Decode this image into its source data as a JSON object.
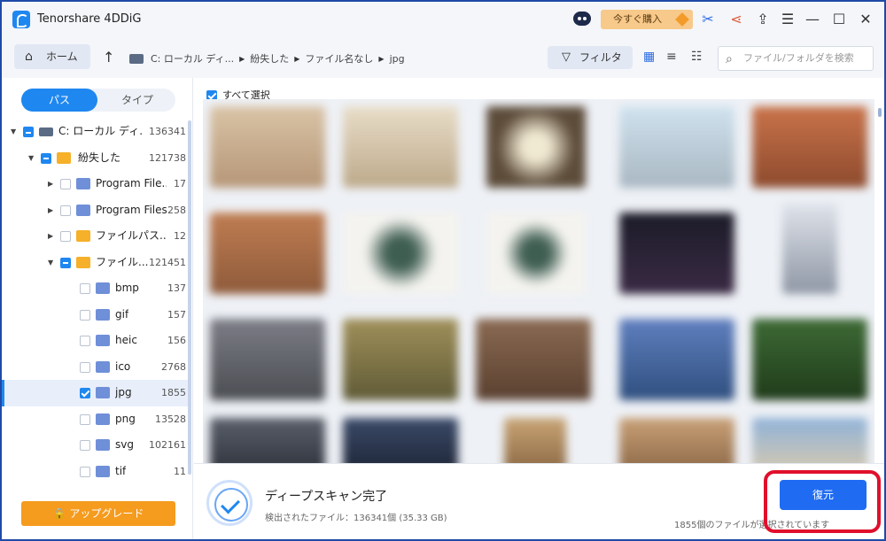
{
  "app": {
    "title": "Tenorshare 4DDiG",
    "buy_label": "今すぐ購入"
  },
  "titlebar_icons": [
    "robot-icon",
    "ticket-icon",
    "share-icon",
    "upload-icon",
    "menu-icon",
    "minimize-icon",
    "maximize-icon",
    "close-icon"
  ],
  "nav": {
    "home_label": "ホーム",
    "breadcrumbs": [
      "C: ローカル ディ...",
      "紛失した",
      "ファイル名なし",
      "jpg"
    ],
    "filter_label": "フィルタ",
    "search_placeholder": "ファイル/フォルダを検索"
  },
  "sidebar": {
    "tabs": [
      "パス",
      "タイプ"
    ],
    "tree": [
      {
        "label": "C: ローカル ディ...",
        "count": "136341"
      },
      {
        "label": "紛失した",
        "count": "121738"
      },
      {
        "label": "Program File...",
        "count": "17"
      },
      {
        "label": "Program Files",
        "count": "258"
      },
      {
        "label": "ファイルパス...",
        "count": "12"
      },
      {
        "label": "ファイル...",
        "count": "121451"
      },
      {
        "label": "bmp",
        "count": "137"
      },
      {
        "label": "gif",
        "count": "157"
      },
      {
        "label": "heic",
        "count": "156"
      },
      {
        "label": "ico",
        "count": "2768"
      },
      {
        "label": "jpg",
        "count": "1855"
      },
      {
        "label": "png",
        "count": "13528"
      },
      {
        "label": "svg",
        "count": "102161"
      },
      {
        "label": "tif",
        "count": "11"
      }
    ],
    "upgrade_label": "アップグレード"
  },
  "main": {
    "select_all_label": "すべて選択"
  },
  "footer": {
    "title": "ディープスキャン完了",
    "subtitle": "検出されたファイル：136341個 (35.33 GB)",
    "recover_label": "復元",
    "selection_note": "1855個のファイルが選択されています"
  },
  "colors": {
    "accent": "#1f87f0",
    "upgrade": "#f59b1e",
    "highlight_box": "#e0102c"
  }
}
